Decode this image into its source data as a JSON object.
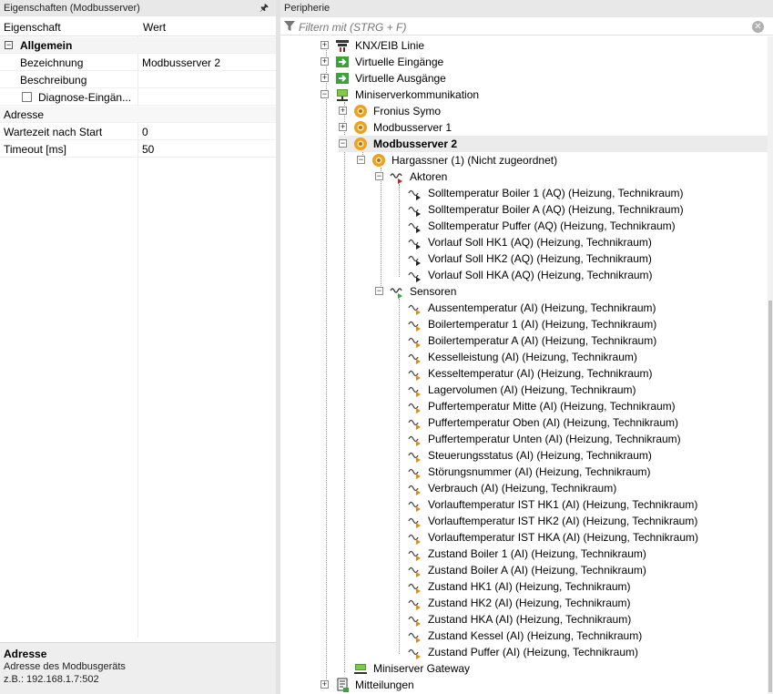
{
  "properties": {
    "title": "Eigenschaften (Modbusserver)",
    "col_property": "Eigenschaft",
    "col_value": "Wert",
    "group": "Allgemein",
    "rows": [
      {
        "name": "Bezeichnung",
        "value": "Modbusserver 2"
      },
      {
        "name": "Beschreibung",
        "value": ""
      },
      {
        "name": "Diagnose-Eingän...",
        "value": ""
      }
    ],
    "rows2": [
      {
        "name": "Adresse",
        "value": ""
      },
      {
        "name": "Wartezeit nach Start",
        "value": "0"
      },
      {
        "name": "Timeout [ms]",
        "value": "50"
      }
    ],
    "description": {
      "title": "Adresse",
      "line1": "Adresse des Modbusgeräts",
      "line2": "z.B.: 192.168.1.7:502"
    }
  },
  "periphery": {
    "title": "Peripherie",
    "filter_placeholder": "Filtern mit (STRG + F)",
    "nodes": [
      {
        "label": "KNX/EIB Linie",
        "icon": "knx-icon"
      },
      {
        "label": "Virtuelle Eingänge",
        "icon": "virtual-input-icon"
      },
      {
        "label": "Virtuelle Ausgänge",
        "icon": "virtual-output-icon"
      },
      {
        "label": "Miniserverkommunikation",
        "icon": "network-icon"
      },
      {
        "label": "Fronius Symo",
        "icon": "gear-sun-icon"
      },
      {
        "label": "Modbusserver 1",
        "icon": "gear-sun-icon"
      },
      {
        "label": "Modbusserver 2",
        "icon": "gear-sun-icon"
      },
      {
        "label": "Hargassner (1) (Nicht zugeordnet)",
        "icon": "gear-sun-icon"
      },
      {
        "label": "Aktoren",
        "icon": "actuators-icon"
      },
      {
        "label": "Sensoren",
        "icon": "sensors-icon"
      },
      {
        "label": "Miniserver Gateway",
        "icon": "gateway-icon"
      },
      {
        "label": "Mitteilungen",
        "icon": "messages-icon"
      }
    ],
    "actuators": [
      "Solltemperatur Boiler 1 (AQ) (Heizung, Technikraum)",
      "Solltemperatur Boiler A (AQ) (Heizung, Technikraum)",
      "Solltemperatur Puffer (AQ) (Heizung, Technikraum)",
      "Vorlauf Soll HK1 (AQ) (Heizung, Technikraum)",
      "Vorlauf Soll HK2 (AQ) (Heizung, Technikraum)",
      "Vorlauf Soll HKA (AQ) (Heizung, Technikraum)"
    ],
    "sensors": [
      "Aussentemperatur (AI) (Heizung, Technikraum)",
      "Boilertemperatur 1 (AI) (Heizung, Technikraum)",
      "Boilertemperatur A (AI) (Heizung, Technikraum)",
      "Kesselleistung (AI) (Heizung, Technikraum)",
      "Kesseltemperatur (AI) (Heizung, Technikraum)",
      "Lagervolumen (AI) (Heizung, Technikraum)",
      "Puffertemperatur Mitte (AI) (Heizung, Technikraum)",
      "Puffertemperatur Oben (AI) (Heizung, Technikraum)",
      "Puffertemperatur Unten (AI) (Heizung, Technikraum)",
      "Steuerungsstatus (AI) (Heizung, Technikraum)",
      "Störungsnummer (AI) (Heizung, Technikraum)",
      "Verbrauch (AI) (Heizung, Technikraum)",
      "Vorlauftemperatur IST HK1 (AI) (Heizung, Technikraum)",
      "Vorlauftemperatur IST HK2 (AI) (Heizung, Technikraum)",
      "Vorlauftemperatur IST HKA (AI) (Heizung, Technikraum)",
      "Zustand Boiler 1 (AI) (Heizung, Technikraum)",
      "Zustand Boiler A (AI) (Heizung, Technikraum)",
      "Zustand HK1 (AI) (Heizung, Technikraum)",
      "Zustand HK2 (AI) (Heizung, Technikraum)",
      "Zustand HKA (AI) (Heizung, Technikraum)",
      "Zustand Kessel (AI) (Heizung, Technikraum)",
      "Zustand Puffer (AI) (Heizung, Technikraum)"
    ]
  },
  "colors": {
    "accent_green": "#3aa33a",
    "gear_orange": "#f0a020",
    "actuator_red": "#d02020",
    "sensor_orange": "#e08a10"
  }
}
